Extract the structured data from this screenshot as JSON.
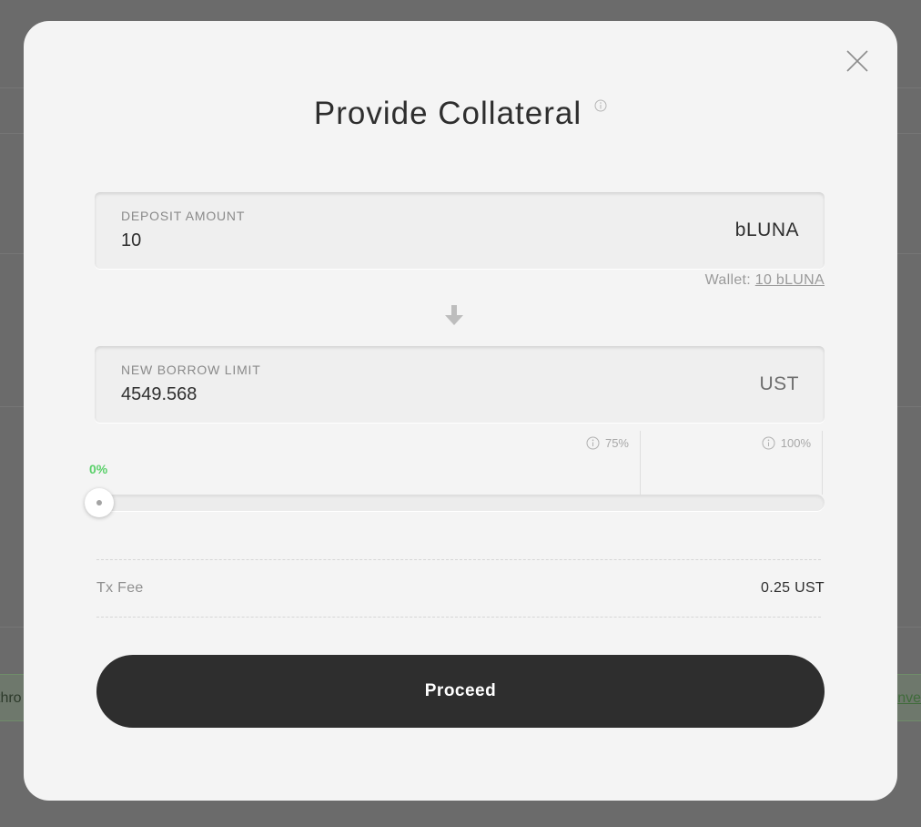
{
  "background": {
    "left_fragment": "thro",
    "right_fragment": "nve"
  },
  "modal": {
    "title": "Provide Collateral",
    "deposit": {
      "label": "DEPOSIT AMOUNT",
      "value": "10",
      "unit": "bLUNA"
    },
    "wallet": {
      "prefix": "Wallet:",
      "balance": "10 bLUNA"
    },
    "borrow_limit": {
      "label": "NEW BORROW LIMIT",
      "value": "4549.568",
      "unit": "UST"
    },
    "ltv": {
      "current_label": "0%",
      "current_fraction": 0,
      "safe_marker": "75%",
      "max_marker": "100%",
      "safe_fraction": 0.75,
      "max_fraction": 1.0
    },
    "tx_fee": {
      "label": "Tx Fee",
      "value": "0.25 UST"
    },
    "proceed_label": "Proceed"
  },
  "colors": {
    "modal_bg": "#f4f4f4",
    "primary_button": "#2e2e2e",
    "ltv_ok": "#5ad06a"
  }
}
